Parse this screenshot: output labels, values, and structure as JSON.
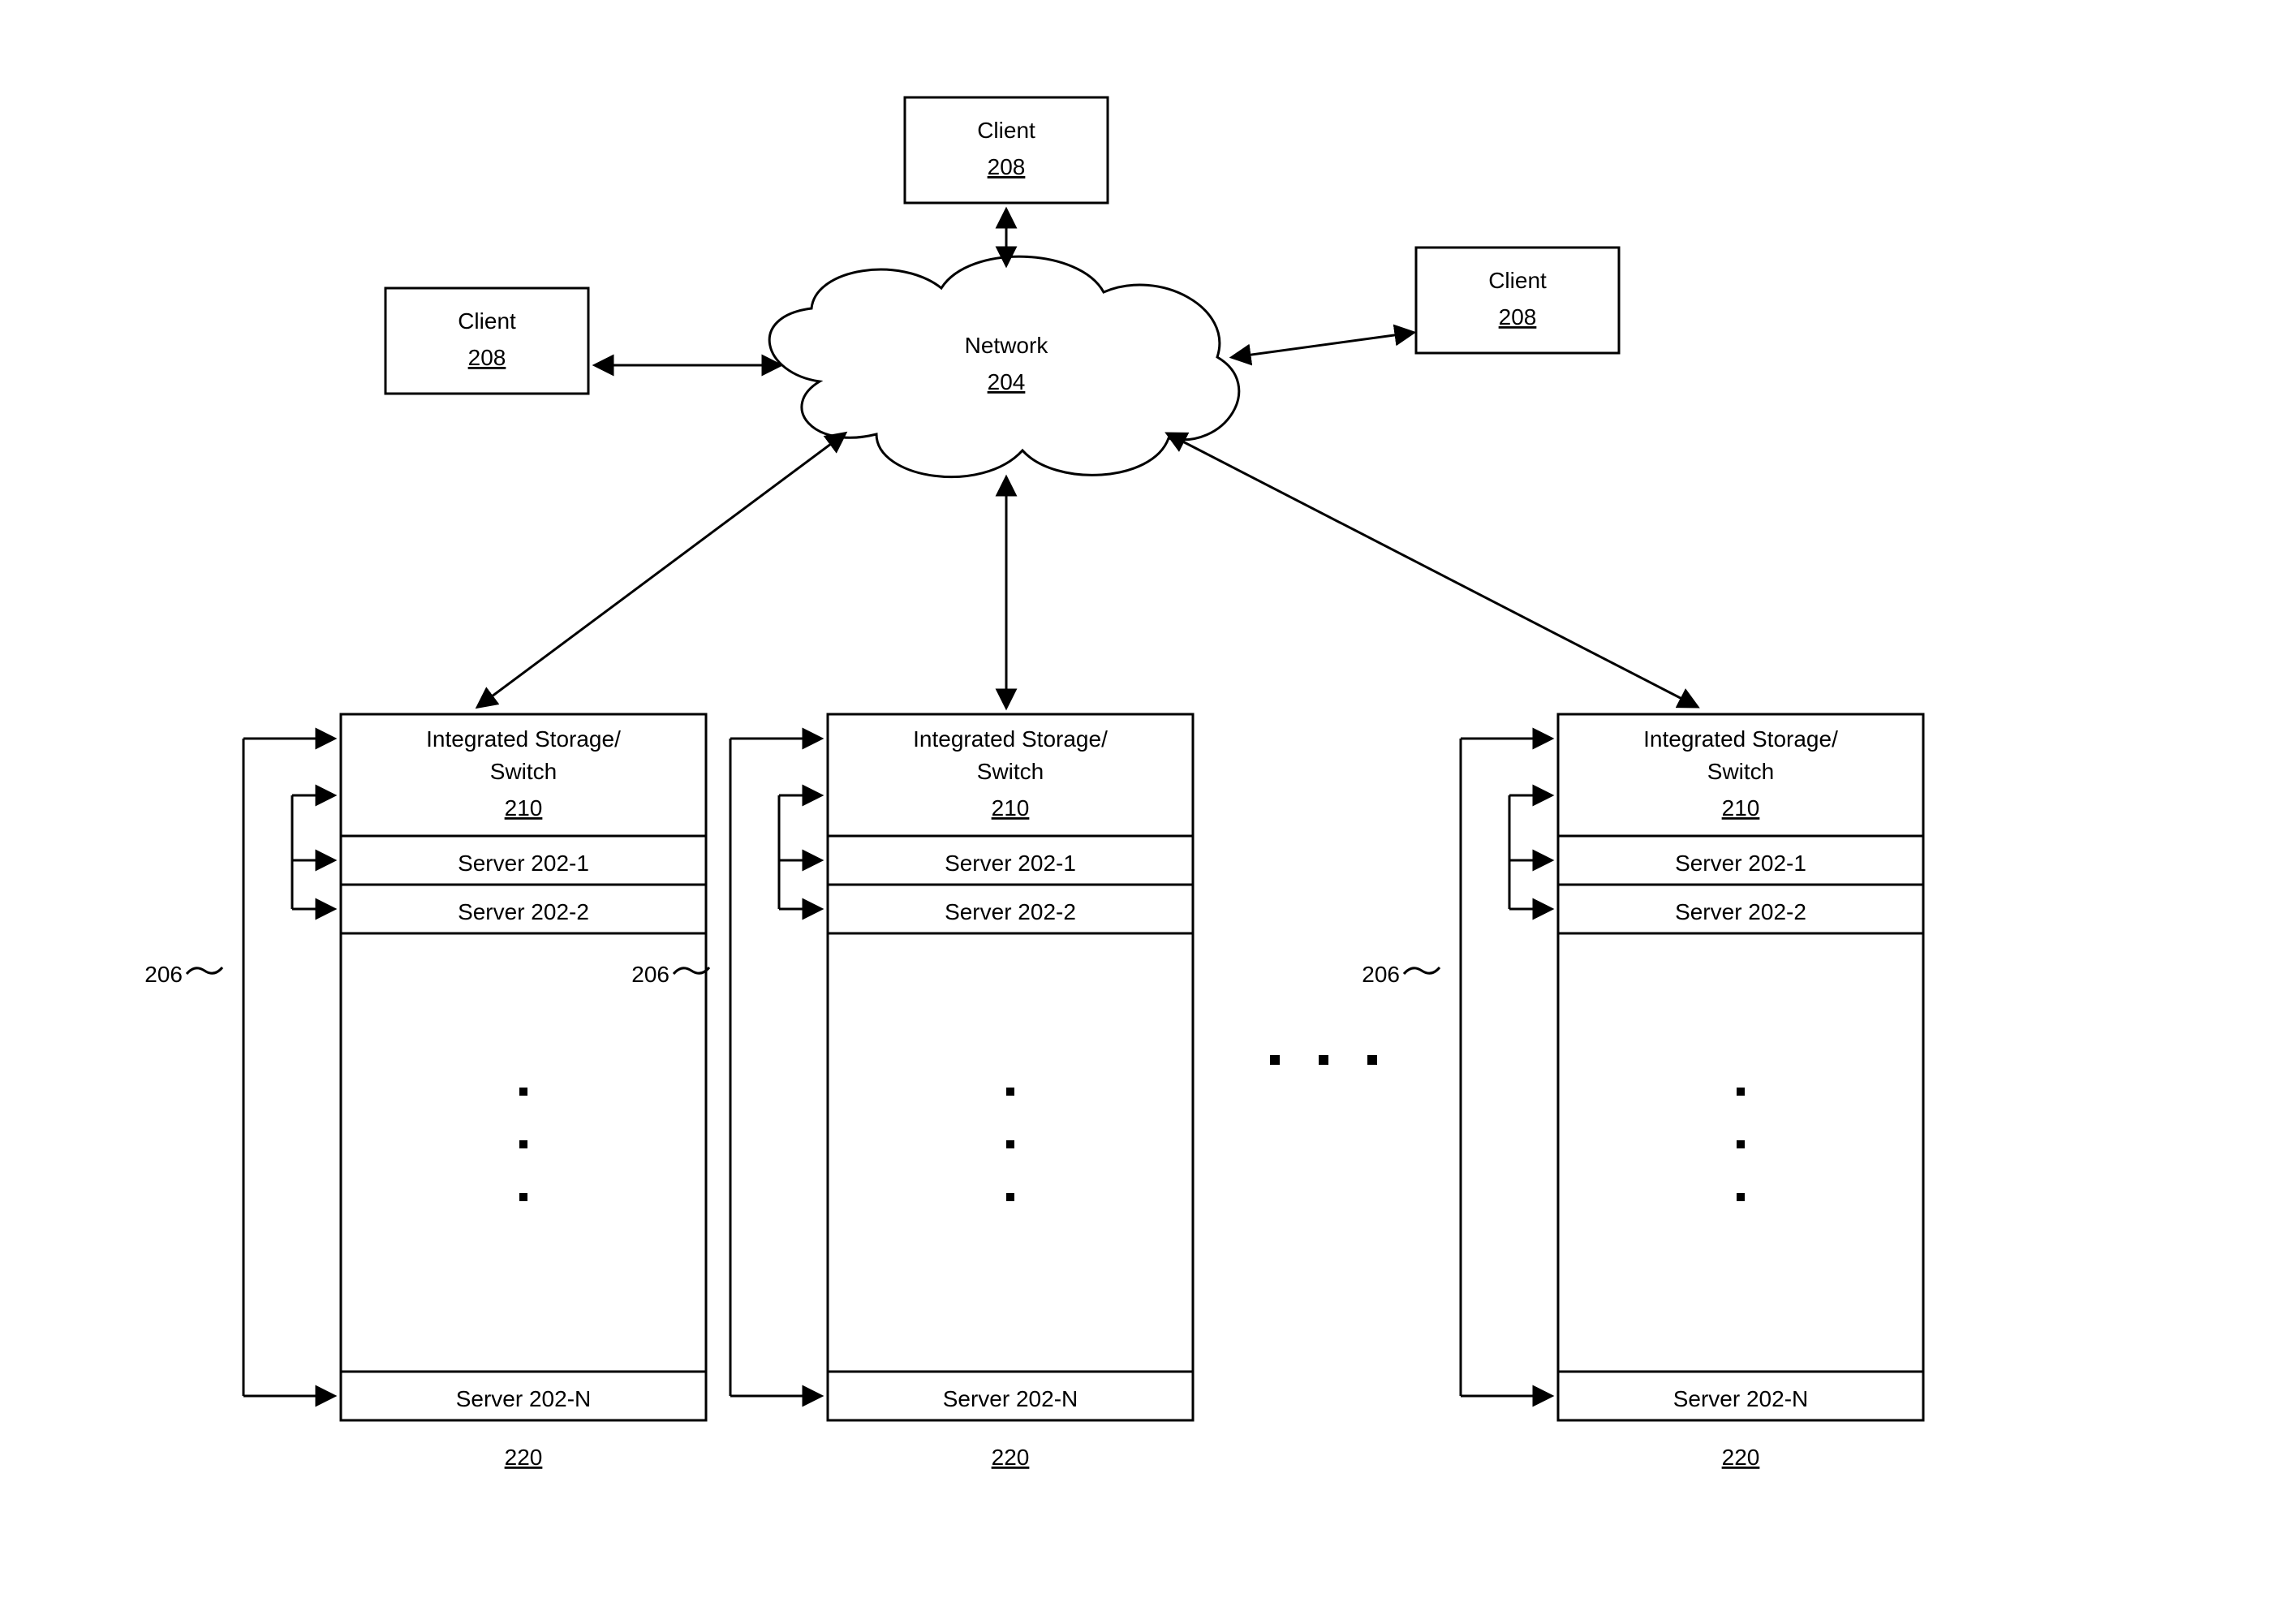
{
  "clients": {
    "label": "Client",
    "ref": "208"
  },
  "network": {
    "label": "Network",
    "ref": "204"
  },
  "rack": {
    "integrated": "Integrated Storage/",
    "switch": "Switch",
    "switch_ref": "210",
    "server1": "Server 202-1",
    "server2": "Server 202-2",
    "serverN": "Server 202-N",
    "rack_ref": "220",
    "bus_ref": "206"
  }
}
